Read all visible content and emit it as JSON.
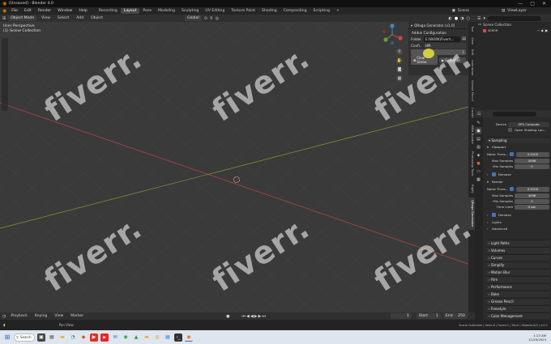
{
  "titlebar": {
    "title": "[Unsaved] - Blender 4.0",
    "min": "—",
    "max": "▢",
    "close": "✕"
  },
  "menu": [
    "File",
    "Edit",
    "Render",
    "Window",
    "Help"
  ],
  "workspaces": [
    "Recording",
    "Layout",
    "Pose",
    "Modeling",
    "Sculpting",
    "UV Editing",
    "Texture Paint",
    "Shading",
    "Compositing",
    "Scripting",
    "+"
  ],
  "scene": {
    "label": "Scene",
    "view_layer": "ViewLayer"
  },
  "vp_header": {
    "mode": "Object Mode",
    "menus": [
      "View",
      "Select",
      "Add",
      "Object"
    ],
    "orientation": "Global"
  },
  "viewport": {
    "perspective": "User Perspective",
    "collection": "(1) Scene Collection"
  },
  "npanel": {
    "title": "QRaga Generator (v1.0)",
    "section": "Addon Configuration",
    "folder_label": "Folder...",
    "folder_value": "E:\\WORK\\Fiverr\\...",
    "config_label": "Confi...",
    "config_value": "HM",
    "slider_value": "1",
    "clear_scene": "Clear Scene",
    "generate": "Generate"
  },
  "ntabs": [
    "Tool",
    "View",
    "Edit",
    "Animation",
    "Grease Pencil",
    "Create",
    "EBM Bundle",
    "Photoshop Tools",
    "Rigify",
    "QRaga Generator"
  ],
  "outliner": {
    "root": "Scene Collection",
    "item": "scene"
  },
  "props": {
    "device_label": "Device",
    "device_value": "GPU Compute",
    "open_shading": "Open Shading Lan...",
    "sampling": "Sampling",
    "viewport": "Viewport",
    "noise_thresh_label": "Noise Thres...",
    "noise_thresh_value": "0.0100",
    "max_samples_label": "Max Samples",
    "max_samples_value": "4096",
    "min_samples_label": "Min Samples",
    "min_samples_value": "0",
    "denoise": "Denoise",
    "render": "Render",
    "r_noise_value": "0.0100",
    "r_max_value": "4096",
    "r_min_value": "0",
    "time_limit_label": "Time Limit",
    "time_limit_value": "0 sec",
    "lights": "Lights",
    "advanced": "Advanced",
    "sections": [
      "Light Paths",
      "Volumes",
      "Curves",
      "Simplify",
      "Motion Blur",
      "Film",
      "Performance",
      "Bake",
      "Grease Pencil",
      "Freestyle",
      "Color Management"
    ]
  },
  "timeline": {
    "playback": "Playback",
    "keying": "Keying",
    "view": "View",
    "marker": "Marker",
    "frame": "1",
    "start_label": "Start",
    "start": "1",
    "end_label": "End",
    "end": "250"
  },
  "statusbar": {
    "left": "Pan View",
    "right": "Scene Collection | Verts:0 | Faces:0 | Tris:0 | Objects:0/0 | 4.0.1"
  },
  "taskbar": {
    "search": "Search",
    "time": "1:23 AM",
    "date": "11/29/2023"
  },
  "watermark": "fiverr."
}
